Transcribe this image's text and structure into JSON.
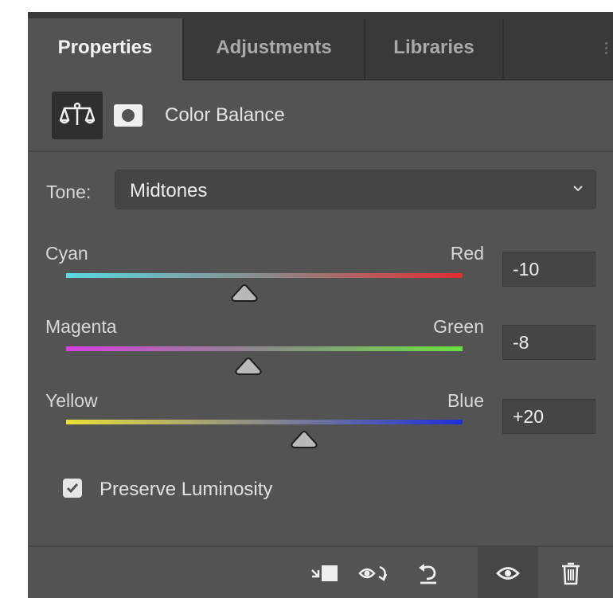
{
  "tabs": [
    {
      "label": "Properties",
      "active": true
    },
    {
      "label": "Adjustments",
      "active": false
    },
    {
      "label": "Libraries",
      "active": false
    }
  ],
  "header": {
    "title": "Color Balance",
    "icons": [
      "color-balance-icon",
      "mask-icon"
    ]
  },
  "tone": {
    "label": "Tone:",
    "selected": "Midtones"
  },
  "sliders": [
    {
      "left_label": "Cyan",
      "right_label": "Red",
      "value": "-10",
      "position": -10,
      "gradient": [
        "#5ad8e4",
        "#e03030"
      ]
    },
    {
      "left_label": "Magenta",
      "right_label": "Green",
      "value": "-8",
      "position": -8,
      "gradient": [
        "#d840e0",
        "#6ce040"
      ]
    },
    {
      "left_label": "Yellow",
      "right_label": "Blue",
      "value": "+20",
      "position": 20,
      "gradient": [
        "#e8e038",
        "#1e2ed8"
      ]
    }
  ],
  "preserve": {
    "label": "Preserve Luminosity",
    "checked": true
  },
  "footer": {
    "icons": [
      "clip-to-layer-icon",
      "view-previous-state-icon",
      "reset-icon",
      "visibility-icon",
      "delete-icon"
    ]
  }
}
